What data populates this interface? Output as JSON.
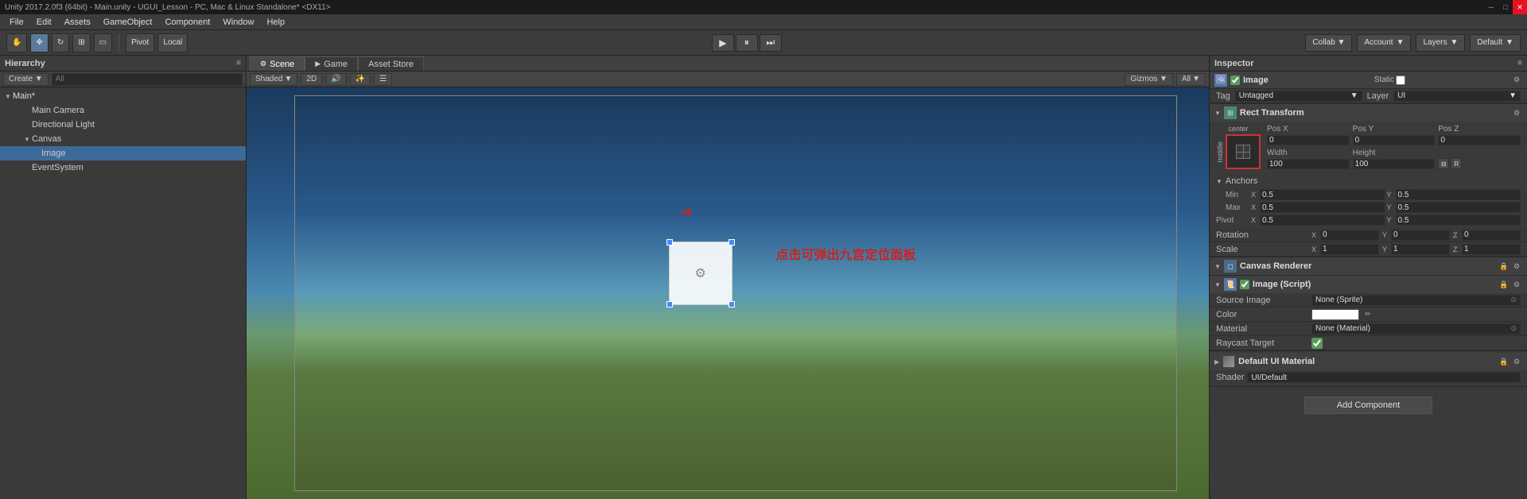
{
  "titlebar": {
    "text": "Unity 2017.2.0f3 (64bit) - Main.unity - UGUI_Lesson - PC, Mac & Linux Standalone* <DX11>"
  },
  "menubar": {
    "items": [
      "File",
      "Edit",
      "Assets",
      "GameObject",
      "Component",
      "Window",
      "Help"
    ]
  },
  "toolbar": {
    "pivot_label": "Pivot",
    "local_label": "Local",
    "play_tooltip": "Play",
    "pause_tooltip": "Pause",
    "step_tooltip": "Step",
    "collab_label": "Collab ▼",
    "account_label": "Account",
    "layers_label": "Layers",
    "default_label": "Default"
  },
  "hierarchy": {
    "panel_title": "Hierarchy",
    "create_label": "Create ▼",
    "search_placeholder": "All",
    "items": [
      {
        "label": "Main*",
        "indent": 0,
        "arrow": "▼",
        "dirty": true
      },
      {
        "label": "Main Camera",
        "indent": 1,
        "arrow": ""
      },
      {
        "label": "Directional Light",
        "indent": 1,
        "arrow": ""
      },
      {
        "label": "Canvas",
        "indent": 1,
        "arrow": "▼"
      },
      {
        "label": "Image",
        "indent": 2,
        "arrow": "",
        "selected": true
      },
      {
        "label": "EventSystem",
        "indent": 1,
        "arrow": ""
      }
    ]
  },
  "scene": {
    "tab_scene": "Scene",
    "tab_game": "Game",
    "tab_asset": "Asset Store",
    "shading": "Shaded",
    "mode_2d": "2D",
    "gizmos": "Gizmos ▼",
    "search_all": "All"
  },
  "annotation": {
    "text": "点击可弹出九宫定位面板",
    "arrow": "→"
  },
  "inspector": {
    "panel_title": "Inspector",
    "component_image": {
      "title": "Image",
      "enabled": true,
      "static_label": "Static",
      "tag_label": "Tag",
      "tag_value": "Untagged",
      "layer_label": "Layer",
      "layer_value": "UI"
    },
    "rect_transform": {
      "title": "Rect Transform",
      "anchor_label": "center",
      "middle_label": "middle",
      "pos_x_label": "Pos X",
      "pos_x_value": "0",
      "pos_y_label": "Pos Y",
      "pos_y_value": "0",
      "pos_z_label": "Pos Z",
      "pos_z_value": "0",
      "width_label": "Width",
      "width_value": "100",
      "height_label": "Height",
      "height_value": "100",
      "anchors_label": "Anchors",
      "min_label": "Min",
      "min_x": "0.5",
      "min_y": "0.5",
      "max_label": "Max",
      "max_x": "0.5",
      "max_y": "0.5",
      "pivot_label": "Pivot",
      "pivot_x": "0.5",
      "pivot_y": "0.5",
      "rotation_label": "Rotation",
      "rot_x": "0",
      "rot_y": "0",
      "rot_z": "0",
      "scale_label": "Scale",
      "scale_x": "1",
      "scale_y": "1",
      "scale_z": "1"
    },
    "canvas_renderer": {
      "title": "Canvas Renderer"
    },
    "image_script": {
      "title": "Image (Script)",
      "source_image_label": "Source Image",
      "source_image_value": "None (Sprite)",
      "color_label": "Color",
      "material_label": "Material",
      "material_value": "None (Material)",
      "raycast_label": "Raycast Target"
    },
    "default_ui_material": {
      "name": "Default UI Material",
      "shader_label": "Shader",
      "shader_value": "UI/Default"
    },
    "add_component": {
      "label": "Add Component"
    }
  }
}
